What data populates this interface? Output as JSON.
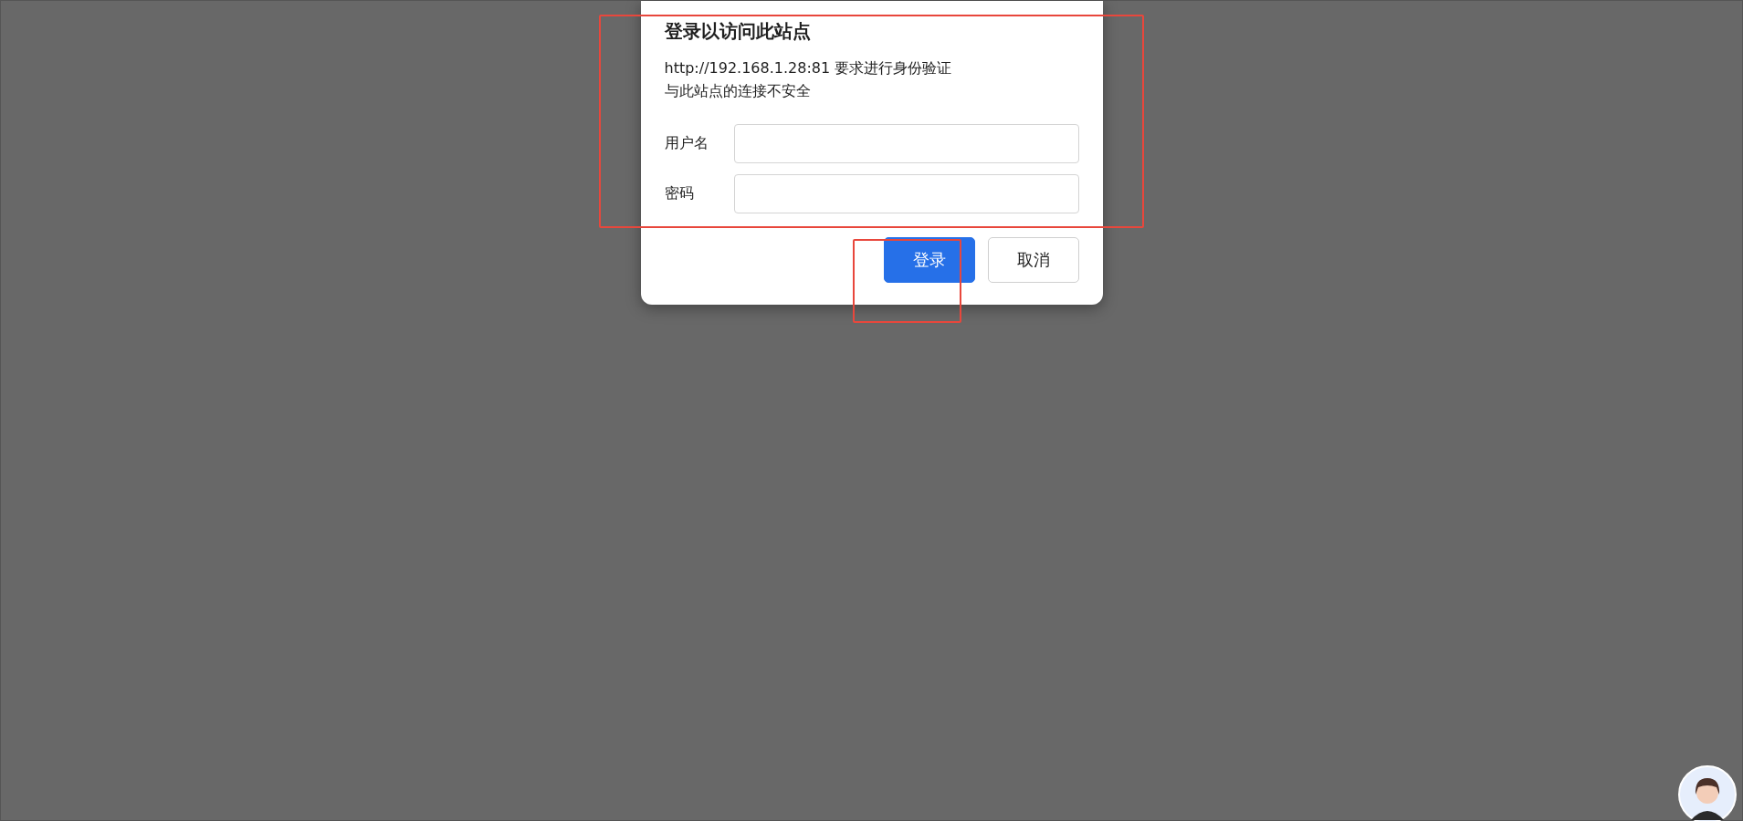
{
  "dialog": {
    "title": "登录以访问此站点",
    "message": [
      "http://192.168.1.28:81 要求进行身份验证",
      "与此站点的连接不安全"
    ],
    "fields": [
      {
        "label": "用户名"
      },
      {
        "label": "密码"
      }
    ],
    "buttons": [
      {
        "label": "登录",
        "kind": "primary"
      },
      {
        "label": "取消",
        "kind": "secondary"
      }
    ]
  }
}
